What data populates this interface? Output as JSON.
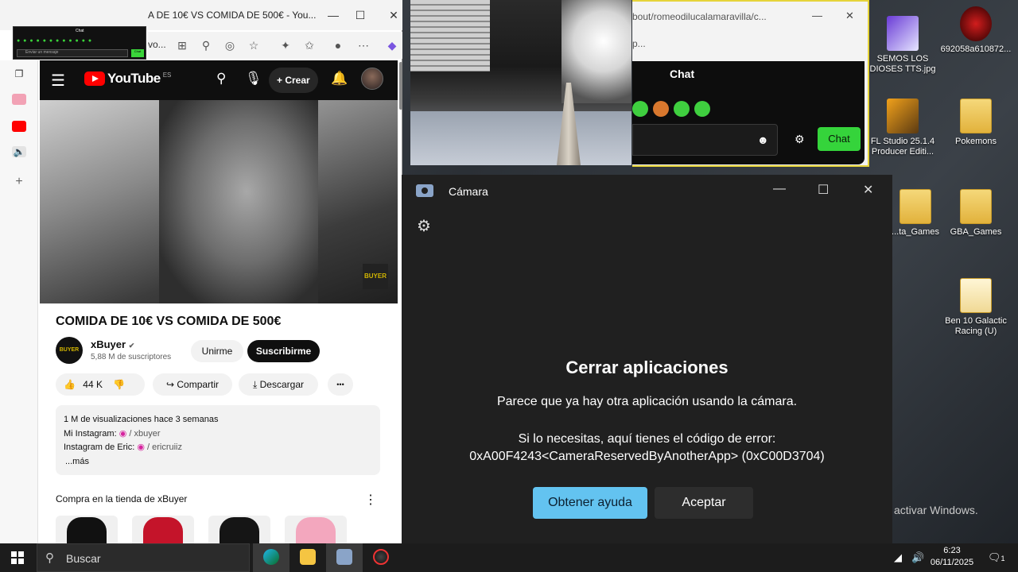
{
  "browser": {
    "tab_title": "A DE 10€ VS COMIDA DE 500€ - You...",
    "url_fragment": "vo...",
    "window_min": "—",
    "window_max": "☐",
    "window_close": "✕"
  },
  "mini_chat": {
    "title": "Chat",
    "placeholder": "Enviar un mensaje",
    "send": "Chat"
  },
  "youtube": {
    "logo": "YouTube",
    "country": "ES",
    "create_label": "Crear",
    "video_badge": "BUYER",
    "title": "COMIDA DE 10€ VS COMIDA DE 500€",
    "channel_avatar_text": "BUYER",
    "channel_name": "xBuyer",
    "verified": "✔",
    "subscribers": "5,88 M de suscriptores",
    "join_label": "Unirme",
    "subscribe_label": "Suscribirme",
    "likes": "44 K",
    "share_label": "Compartir",
    "download_label": "Descargar",
    "more_actions": "•••",
    "description": {
      "stats": "1 M de visualizaciones  hace 3 semanas",
      "line2_label": "Mi Instagram:",
      "line2_handle": "/ xbuyer",
      "line3_label": "Instagram de Eric:",
      "line3_handle": "/ ericruiiz",
      "more": "...más"
    },
    "shop_title": "Compra en la tienda de xBuyer",
    "shop_more": "⋮"
  },
  "chat_window": {
    "url": "bout/romeodilucalamaravilla/c...",
    "row2": "p...",
    "title": "Chat",
    "send_label": "Chat",
    "emoji_icon": "☻",
    "gear_icon": "⚙"
  },
  "camera_app": {
    "title": "Cámara",
    "heading": "Cerrar aplicaciones",
    "message": "Parece que ya hay otra aplicación usando la cámara.",
    "error_line1": "Si lo necesitas, aquí tienes el código de error:",
    "error_line2": "0xA00F4243<CameraReservedByAnotherApp> (0xC00D3704)",
    "help_button": "Obtener ayuda",
    "accept_button": "Aceptar",
    "min": "—",
    "max": "☐",
    "close": "✕",
    "settings_icon": "⚙"
  },
  "desktop": {
    "icons": [
      {
        "label": "SEMOS LOS DIOSES TTS.jpg"
      },
      {
        "label": "692058a610872..."
      },
      {
        "label": "FL Studio 25.1.4 Producer Editi..."
      },
      {
        "label": "Pokemons"
      },
      {
        "label": "...ta_Games"
      },
      {
        "label": "GBA_Games"
      },
      {
        "label": "Ben 10 Galactic Racing (U)"
      }
    ],
    "activate_text": "activar Windows."
  },
  "taskbar": {
    "search_placeholder": "Buscar",
    "time": "6:23",
    "date": "06/11/2025",
    "notif_count": "1"
  },
  "colors": {
    "youtube_red": "#ff0000",
    "chat_green": "#35d43b",
    "help_blue": "#63c3f0",
    "dialog_bg": "#202020"
  }
}
